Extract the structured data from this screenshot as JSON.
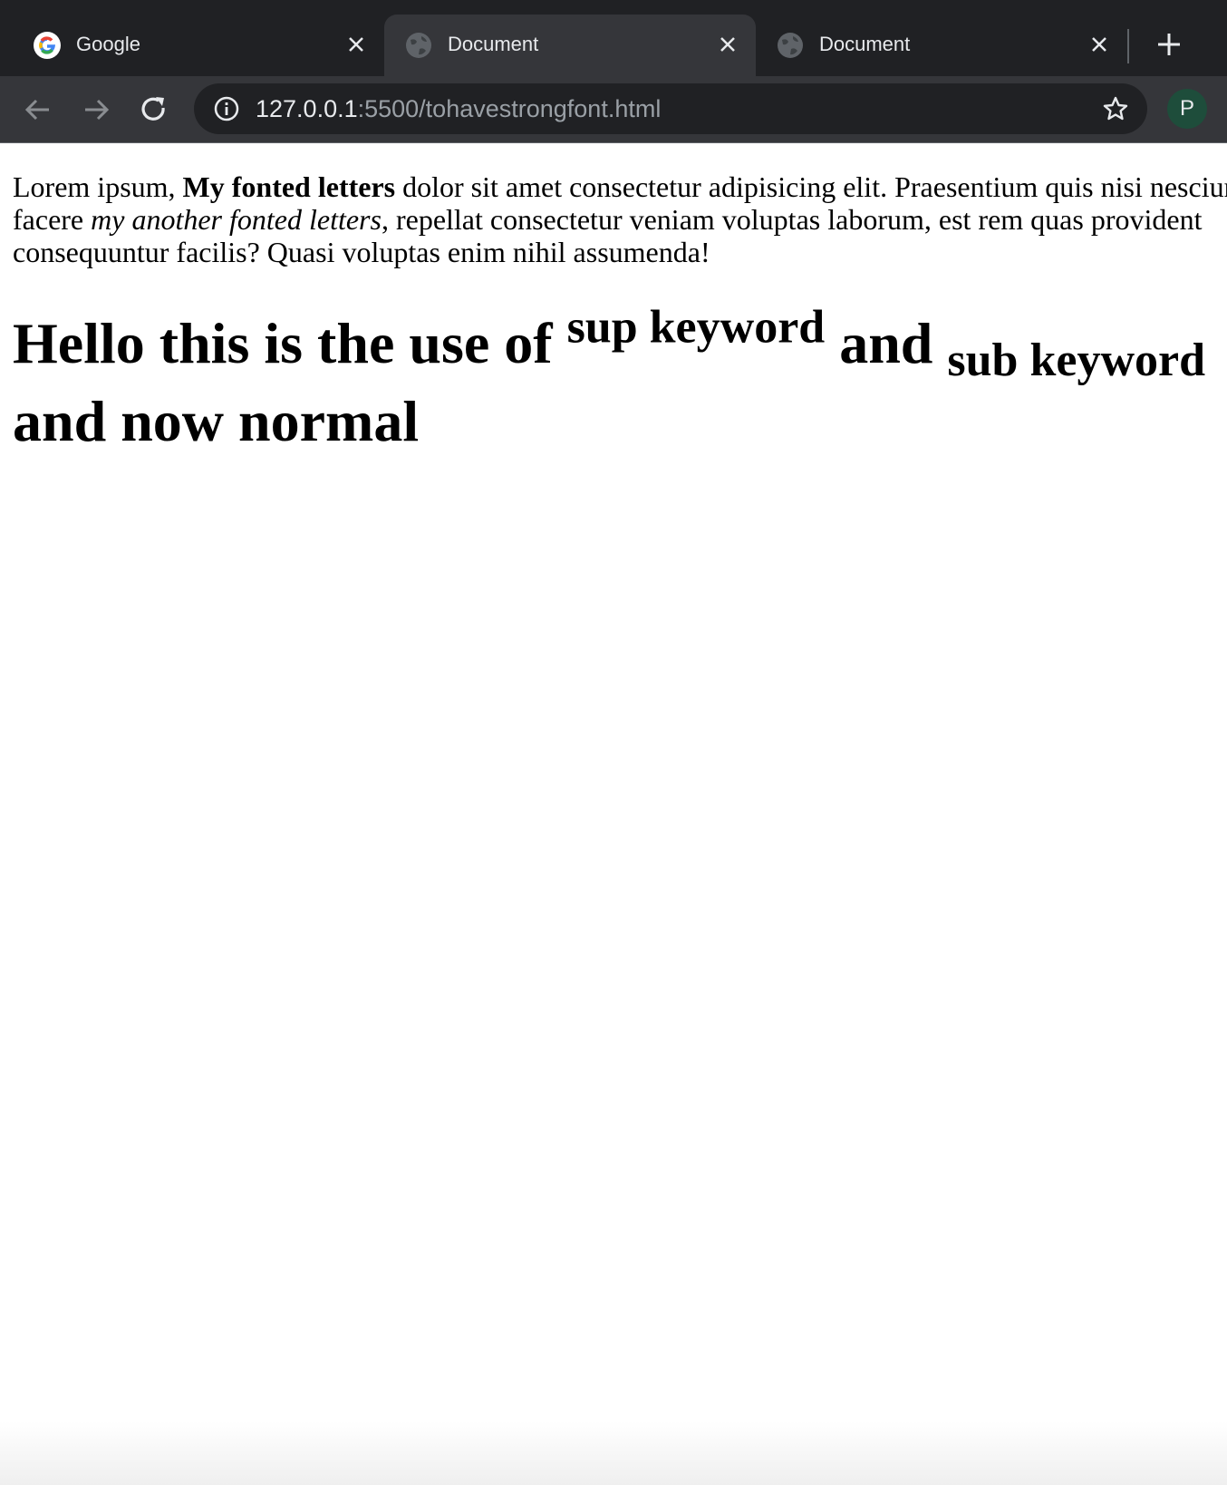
{
  "browser": {
    "tabs": [
      {
        "title": "Google",
        "favicon": "google-g-icon",
        "active": false
      },
      {
        "title": "Document",
        "favicon": "globe-icon",
        "active": true
      },
      {
        "title": "Document",
        "favicon": "globe-icon",
        "active": false
      }
    ],
    "address": {
      "host": "127.0.0.1",
      "rest": ":5500/tohavestrongfont.html"
    },
    "profile_initial": "P",
    "colors": {
      "tabstrip": "#202124",
      "toolbar": "#35363a",
      "omnibox": "#202124",
      "avatar": "#1e4d3b"
    }
  },
  "page": {
    "paragraph": {
      "intro": "Lorem ipsum, ",
      "bold": "My fonted letters",
      "middle": " dolor sit amet consectetur adipisicing elit. Praesentium quis nisi nesciunt facere ",
      "italic": "my another fonted letters",
      "end": ", repellat consectetur veniam voluptas laborum, est rem quas provident consequuntur facilis? Quasi voluptas enim nihil assumenda!"
    },
    "heading": {
      "part1": "Hello this is the use of ",
      "sup": "sup keyword",
      "part2": " and ",
      "sub": "sub keyword",
      "part3": " and now normal"
    }
  }
}
